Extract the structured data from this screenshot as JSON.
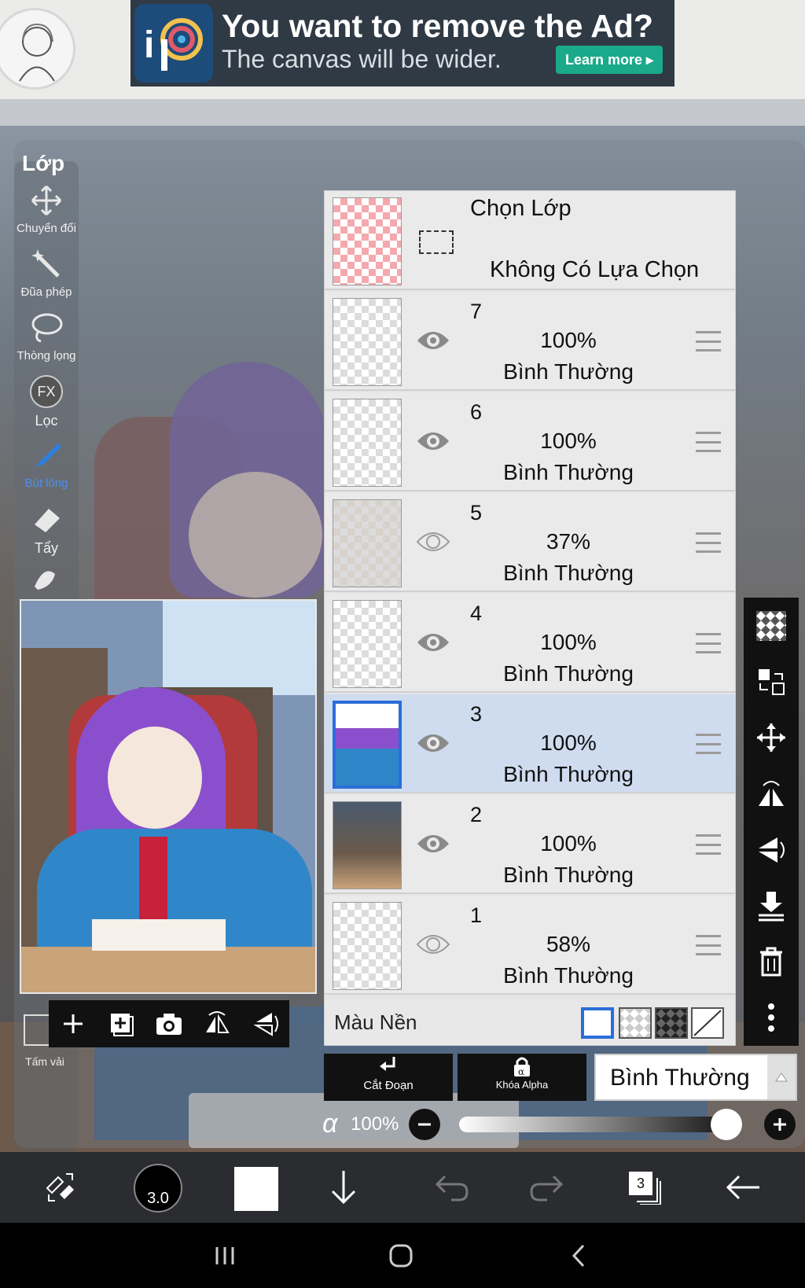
{
  "ad": {
    "title": "You want to remove the Ad?",
    "subtitle": "The canvas will be wider.",
    "cta": "Learn more ▸",
    "logo_text": "iP"
  },
  "tools": {
    "panel_title": "Lớp",
    "items": [
      {
        "label": "Chuyển đổi",
        "icon": "transform-icon"
      },
      {
        "label": "Đũa phép",
        "icon": "magic-wand-icon"
      },
      {
        "label": "Thòng lọng",
        "icon": "lasso-icon"
      },
      {
        "label": "Lọc",
        "icon": "fx-icon",
        "glyph": "FX"
      },
      {
        "label": "Bút lông",
        "icon": "brush-icon"
      },
      {
        "label": "Tẩy",
        "icon": "eraser-icon"
      }
    ],
    "bottom_label": "Tấm vải"
  },
  "layers": {
    "select_row": {
      "title": "Chọn Lớp",
      "status": "Không Có Lựa Chọn"
    },
    "rows": [
      {
        "num": "7",
        "opacity": "100%",
        "blend": "Bình Thường",
        "visible": true,
        "selected": false
      },
      {
        "num": "6",
        "opacity": "100%",
        "blend": "Bình Thường",
        "visible": true,
        "selected": false
      },
      {
        "num": "5",
        "opacity": "37%",
        "blend": "Bình Thường",
        "visible": false,
        "selected": false
      },
      {
        "num": "4",
        "opacity": "100%",
        "blend": "Bình Thường",
        "visible": true,
        "selected": false
      },
      {
        "num": "3",
        "opacity": "100%",
        "blend": "Bình Thường",
        "visible": true,
        "selected": true
      },
      {
        "num": "2",
        "opacity": "100%",
        "blend": "Bình Thường",
        "visible": true,
        "selected": false
      },
      {
        "num": "1",
        "opacity": "58%",
        "blend": "Bình Thường",
        "visible": false,
        "selected": false
      }
    ],
    "background_label": "Màu Nền"
  },
  "controls": {
    "clip_label": "Cắt Đoạn",
    "alpha_lock_label": "Khóa Alpha",
    "blend_mode": "Bình Thường",
    "alpha_symbol": "α",
    "opacity_value": "100%",
    "opacity_fraction": 1.0
  },
  "bottom_bar": {
    "brush_size": "3.0",
    "layer_count": "3"
  },
  "colors": {
    "selection_blue": "#2a6ed8",
    "selected_row": "#cfdcf0",
    "toolbar": "#111111",
    "ad_green": "#1aa98a"
  }
}
